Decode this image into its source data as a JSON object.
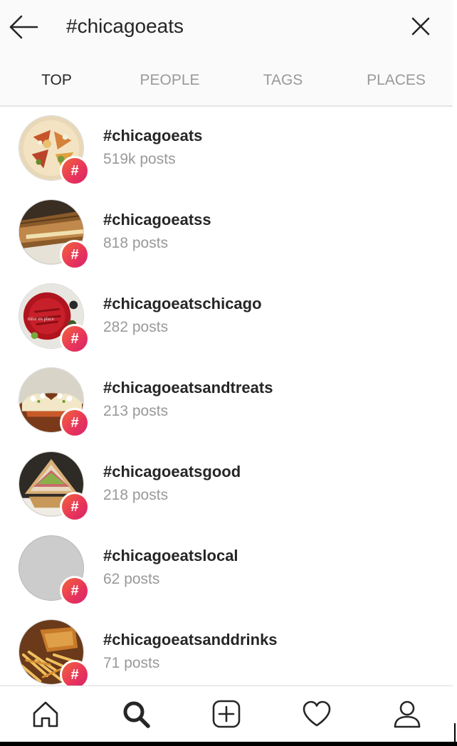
{
  "search": {
    "query": "#chicagoeats"
  },
  "tabs": [
    {
      "label": "TOP",
      "active": true
    },
    {
      "label": "PEOPLE",
      "active": false
    },
    {
      "label": "TAGS",
      "active": false
    },
    {
      "label": "PLACES",
      "active": false
    }
  ],
  "results": [
    {
      "tag": "#chicagoeats",
      "count": "519k posts",
      "thumb": "nachos"
    },
    {
      "tag": "#chicagoeatss",
      "count": "818 posts",
      "thumb": "sandwich"
    },
    {
      "tag": "#chicagoeatschicago",
      "count": "282 posts",
      "thumb": "red-plate",
      "thumb_text": "mise en place"
    },
    {
      "tag": "#chicagoeatsandtreats",
      "count": "213 posts",
      "thumb": "tacos"
    },
    {
      "tag": "#chicagoeatsgood",
      "count": "218 posts",
      "thumb": "sub-sandwich"
    },
    {
      "tag": "#chicagoeatslocal",
      "count": "62 posts",
      "thumb": "placeholder"
    },
    {
      "tag": "#chicagoeatsanddrinks",
      "count": "71 posts",
      "thumb": "fries-chicken"
    }
  ],
  "badge_symbol": "#",
  "nav": {
    "items": [
      "home-icon",
      "search-icon",
      "add-post-icon",
      "activity-heart-icon",
      "profile-icon"
    ],
    "active": "search-icon"
  },
  "colors": {
    "text_primary": "#262626",
    "text_secondary": "#999999",
    "header_bg": "#fafafa",
    "badge_gradient_start": "#f0643c",
    "badge_gradient_end": "#d6246a"
  }
}
